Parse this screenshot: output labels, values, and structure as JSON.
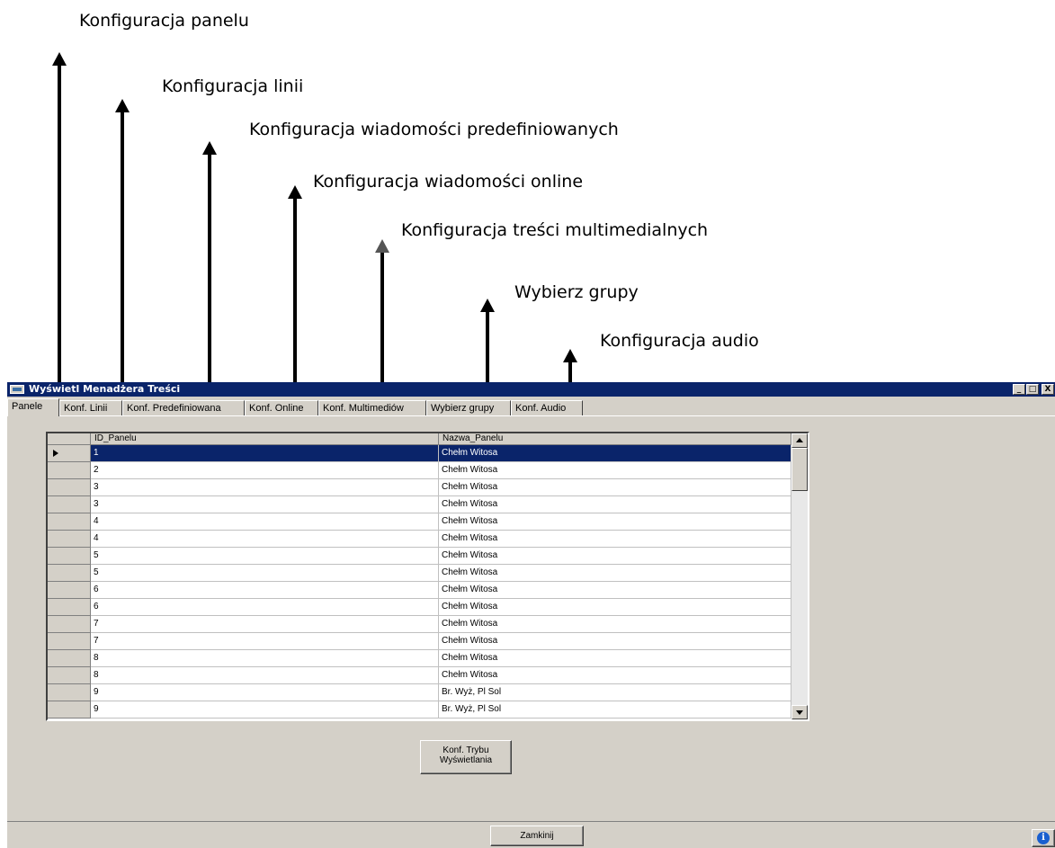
{
  "annotations": [
    "Konfiguracja panelu",
    "Konfiguracja linii",
    "Konfiguracja wiadomości predefiniowanych",
    "Konfiguracja wiadomości online",
    "Konfiguracja treści multimedialnych",
    "Wybierz grupy",
    "Konfiguracja audio"
  ],
  "window": {
    "title": "Wyświetl Menadżera Treści",
    "minimize": "_",
    "maximize": "□",
    "close": "X"
  },
  "tabs": [
    "Panele",
    "Konf. Linii",
    "Konf. Predefiniowana",
    "Konf. Online",
    "Konf. Multimediów",
    "Wybierz grupy",
    "Konf. Audio"
  ],
  "active_tab": "Panele",
  "grid": {
    "columns": [
      "ID_Panelu",
      "Nazwa_Panelu"
    ],
    "rows": [
      [
        "1",
        "Chełm Witosa"
      ],
      [
        "2",
        "Chełm Witosa"
      ],
      [
        "3",
        "Chełm Witosa"
      ],
      [
        "3",
        "Chełm Witosa"
      ],
      [
        "4",
        "Chełm Witosa"
      ],
      [
        "4",
        "Chełm Witosa"
      ],
      [
        "5",
        "Chełm Witosa"
      ],
      [
        "5",
        "Chełm Witosa"
      ],
      [
        "6",
        "Chełm Witosa"
      ],
      [
        "6",
        "Chełm Witosa"
      ],
      [
        "7",
        "Chełm Witosa"
      ],
      [
        "7",
        "Chełm Witosa"
      ],
      [
        "8",
        "Chełm Witosa"
      ],
      [
        "8",
        "Chełm Witosa"
      ],
      [
        "9",
        "Br. Wyż, Pl Sol"
      ],
      [
        "9",
        "Br. Wyż, Pl Sol"
      ]
    ],
    "selected_row": 1
  },
  "buttons": {
    "display_mode_line1": "Konf. Trybu",
    "display_mode_line2": "Wyświetlania",
    "close": "Zamkinij"
  },
  "icons": {
    "info": "i"
  }
}
